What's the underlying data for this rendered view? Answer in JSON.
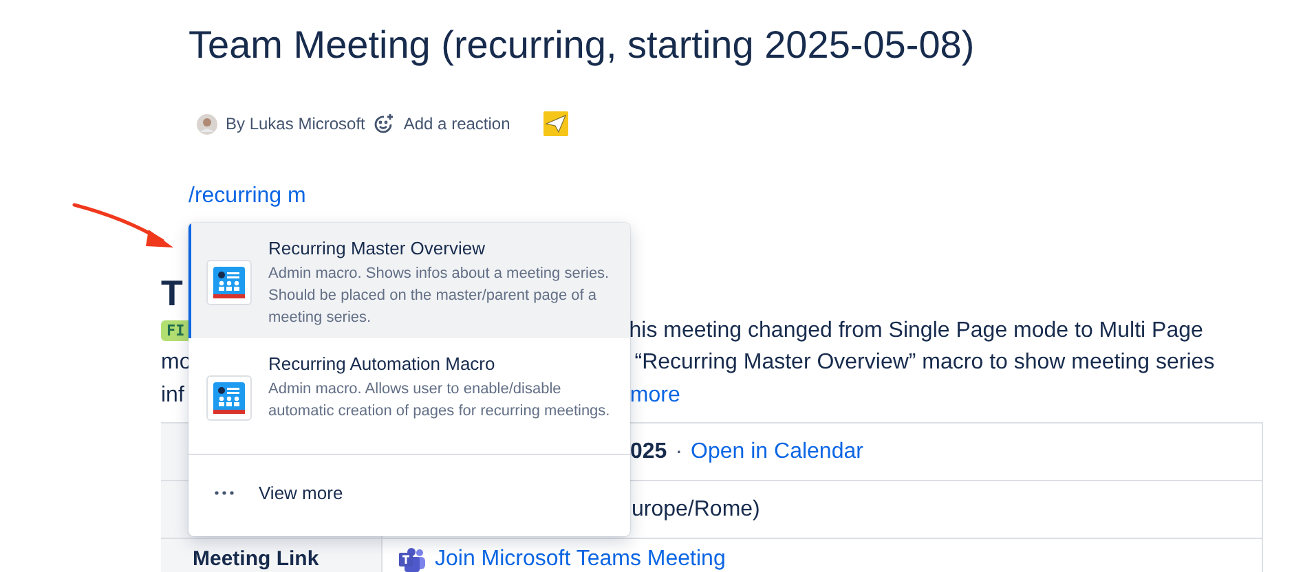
{
  "page": {
    "title": "Team Meeting (recurring, starting 2025-05-08)",
    "author": "By Lukas Microsoft",
    "reaction": "Add a reaction",
    "slash_command": "/recurring m"
  },
  "behind": {
    "heading": "T",
    "lines": [
      {
        "kind": "badge",
        "left": "FI",
        "right": "his meeting changed from Single Page mode to Multi Page"
      },
      {
        "kind": "text",
        "left": "mo",
        "right": "“Recurring Master Overview” macro to show meeting series"
      },
      {
        "kind": "link",
        "left": "inf",
        "right": "more"
      }
    ],
    "table": [
      {
        "kind": "date",
        "value": "025",
        "separator": "·",
        "link": "Open in Calendar"
      },
      {
        "kind": "text",
        "value": "urope/Rome)"
      },
      {
        "kind": "meeting",
        "label": "Meeting Link",
        "link": "Join Microsoft Teams Meeting"
      }
    ]
  },
  "menu": {
    "items": [
      {
        "title": "Recurring Master Overview",
        "description": "Admin macro. Shows infos about a meeting series. Should be placed on the master/parent page of a meeting series.",
        "selected": true
      },
      {
        "title": "Recurring Automation Macro",
        "description": "Admin macro. Allows user to enable/disable automatic creation of pages for recurring meetings.",
        "selected": false
      }
    ],
    "view_more": "View more"
  }
}
